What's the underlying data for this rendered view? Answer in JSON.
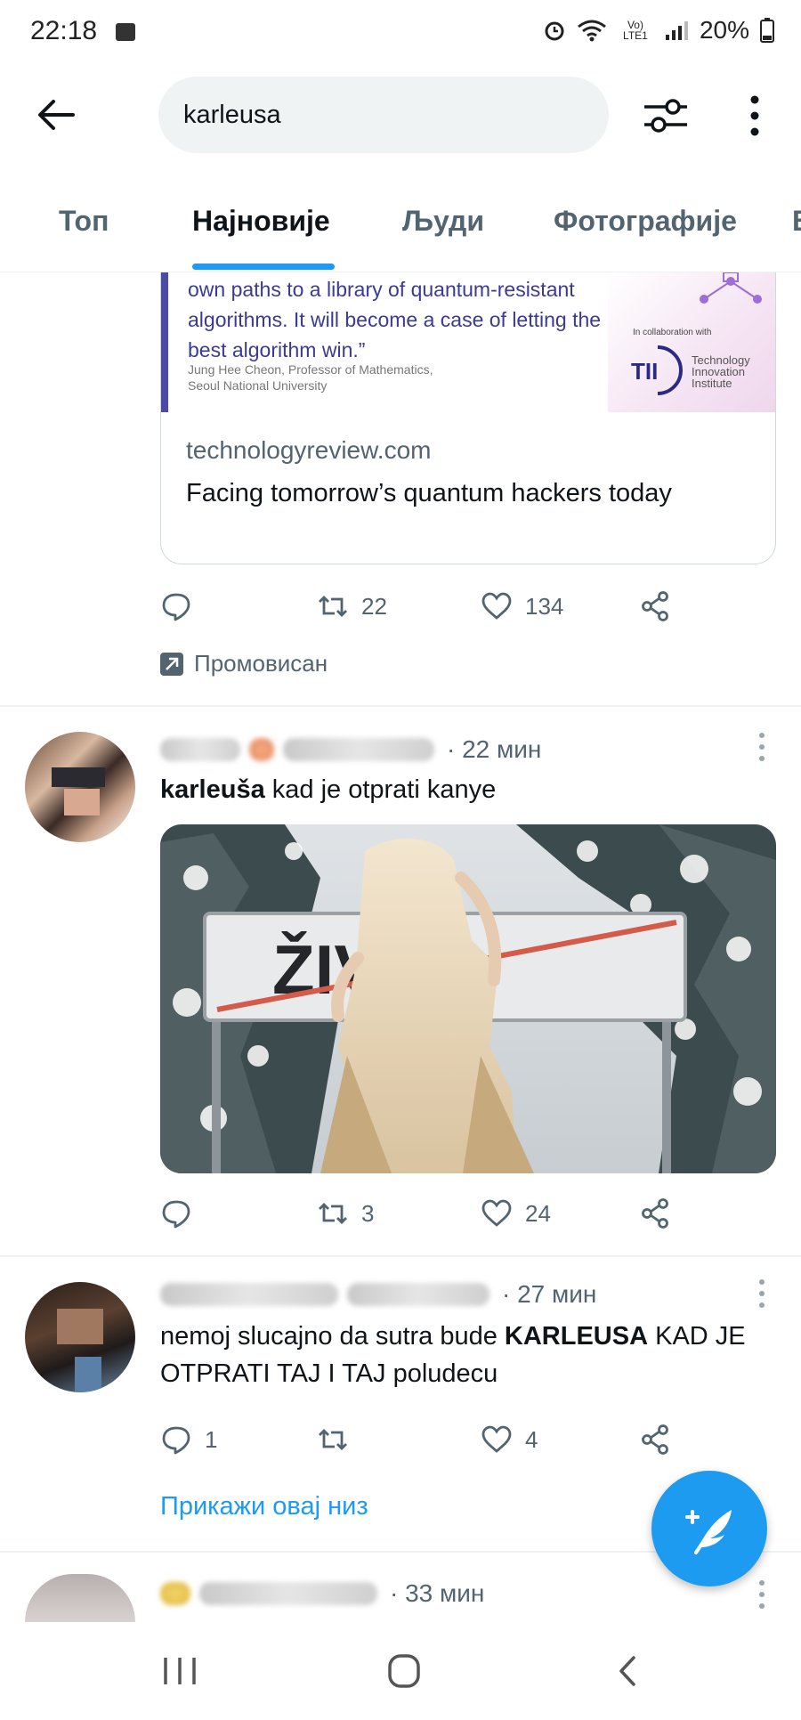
{
  "status_bar": {
    "time": "22:18",
    "network": "Vo) LTE1",
    "battery": "20%"
  },
  "search": {
    "query": "karleusa"
  },
  "tabs": [
    {
      "label": "Топ",
      "active": false
    },
    {
      "label": "Најновије",
      "active": true
    },
    {
      "label": "Људи",
      "active": false
    },
    {
      "label": "Фотографије",
      "active": false
    }
  ],
  "promo_card": {
    "quote": "own paths to a library of quantum-resistant algorithms. It will become a case of letting the best algorithm win.”",
    "author_line1": "Jung Hee Cheon, Professor of Mathematics,",
    "author_line2": "Seoul National University",
    "collab_text": "In collaboration with",
    "logo_text": "TII",
    "logo_caption": "Technology Innovation Institute",
    "domain": "technologyreview.com",
    "title": "Facing tomorrow’s quantum hackers today",
    "retweets": "22",
    "likes": "134",
    "promoted_label": "Промовисан"
  },
  "tweets": [
    {
      "time": "· 22 мин",
      "text_bold": "karleuša",
      "text_rest": " kad je otprati kanye",
      "sign_text": "ŽIVOT",
      "retweets": "3",
      "likes": "24"
    },
    {
      "time": "· 27 мин",
      "text_before": "nemoj slucajno da sutra bude ",
      "text_bold": "KARLEUSA",
      "text_after": " KAD JE OTPRATI TAJ I TAJ poludecu",
      "replies": "1",
      "likes": "4",
      "show_thread": "Прикажи овај низ"
    },
    {
      "time": "· 33 мин"
    }
  ],
  "colors": {
    "accent": "#1d9bf0",
    "text_primary": "#0f1419",
    "text_secondary": "#536471"
  }
}
